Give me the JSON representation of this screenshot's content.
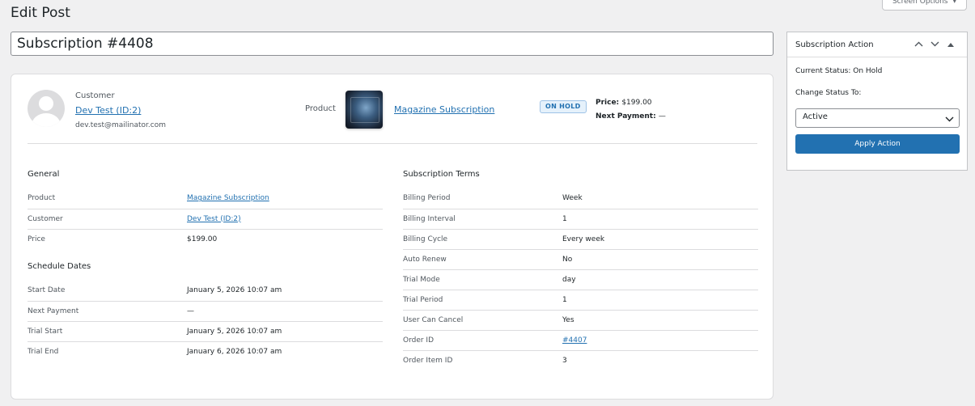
{
  "page": {
    "title": "Edit Post",
    "screen_options_label": "Screen Options",
    "post_title": "Subscription #4408"
  },
  "summary": {
    "customer_label": "Customer",
    "customer_name": "Dev Test (ID:2)",
    "customer_email": "dev.test@mailinator.com",
    "product_label": "Product",
    "product_name": "Magazine Subscription",
    "status_badge": "ON HOLD",
    "price_label": "Price:",
    "price_value": "$199.00",
    "next_payment_label": "Next Payment:",
    "next_payment_value": "—"
  },
  "general": {
    "title": "General",
    "rows": [
      {
        "label": "Product",
        "value": "Magazine Subscription",
        "link": true
      },
      {
        "label": "Customer",
        "value": "Dev Test (ID:2)",
        "link": true
      },
      {
        "label": "Price",
        "value": "$199.00",
        "link": false
      }
    ]
  },
  "schedule": {
    "title": "Schedule Dates",
    "rows": [
      {
        "label": "Start Date",
        "value": "January 5, 2026 10:07 am"
      },
      {
        "label": "Next Payment",
        "value": "—"
      },
      {
        "label": "Trial Start",
        "value": "January 5, 2026 10:07 am"
      },
      {
        "label": "Trial End",
        "value": "January 6, 2026 10:07 am"
      }
    ]
  },
  "terms": {
    "title": "Subscription Terms",
    "rows": [
      {
        "label": "Billing Period",
        "value": "Week",
        "link": false
      },
      {
        "label": "Billing Interval",
        "value": "1",
        "link": false
      },
      {
        "label": "Billing Cycle",
        "value": "Every week",
        "link": false
      },
      {
        "label": "Auto Renew",
        "value": "No",
        "link": false
      },
      {
        "label": "Trial Mode",
        "value": "day",
        "link": false
      },
      {
        "label": "Trial Period",
        "value": "1",
        "link": false
      },
      {
        "label": "User Can Cancel",
        "value": "Yes",
        "link": false
      },
      {
        "label": "Order ID",
        "value": "#4407",
        "link": true
      },
      {
        "label": "Order Item ID",
        "value": "3",
        "link": false
      }
    ]
  },
  "sidebar": {
    "title": "Subscription Action",
    "current_status_label": "Current Status:",
    "current_status_value": "On Hold",
    "change_status_label": "Change Status To:",
    "selected_status": "Active",
    "apply_label": "Apply Action"
  },
  "icons": {
    "up": "chevron-up-icon",
    "down": "chevron-down-icon",
    "toggle": "triangle-up-icon"
  },
  "colors": {
    "accent": "#2271b1",
    "badge_bg": "#e5f1fb",
    "page_bg": "#f0f0f1"
  }
}
